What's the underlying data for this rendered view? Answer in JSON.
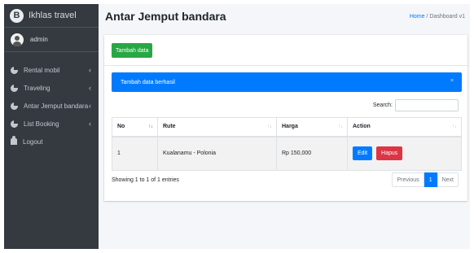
{
  "sidebar": {
    "brand": {
      "logo_letter": "B",
      "text": "Ikhlas travel"
    },
    "user": {
      "name": "admin"
    },
    "items": [
      {
        "label": "Rental mobil",
        "icon": "circle-icon",
        "has_chevron": true
      },
      {
        "label": "Traveling",
        "icon": "circle-icon",
        "has_chevron": true
      },
      {
        "label": "Antar Jemput bandara",
        "icon": "circle-icon",
        "has_chevron": true
      },
      {
        "label": "List Booking",
        "icon": "circle-icon",
        "has_chevron": true
      },
      {
        "label": "Logout",
        "icon": "user-icon",
        "has_chevron": false
      }
    ],
    "chevron_glyph": "‹"
  },
  "header": {
    "title": "Antar Jemput bandara",
    "breadcrumb": {
      "home": "Home",
      "separator": "/",
      "current": "Dashboard v1"
    }
  },
  "main": {
    "add_button": "Tambah data",
    "alert": {
      "text": "Tambah data berhasil",
      "close": "×"
    },
    "search": {
      "label": "Search:",
      "value": ""
    },
    "table": {
      "columns": [
        "No",
        "Rute",
        "Harga",
        "Action"
      ],
      "rows": [
        {
          "no": "1",
          "rute": "Kualanamu - Polonia",
          "harga": "Rp 150,000",
          "edit_label": "Edit",
          "delete_label": "Hapus"
        }
      ]
    },
    "info": "Showing 1 to 1 of 1 entries",
    "pagination": {
      "previous": "Previous",
      "page": "1",
      "next": "Next"
    }
  },
  "colors": {
    "sidebar_bg": "#343a40",
    "primary": "#007bff",
    "success": "#28a745",
    "danger": "#dc3545",
    "content_bg": "#f4f6f9"
  }
}
